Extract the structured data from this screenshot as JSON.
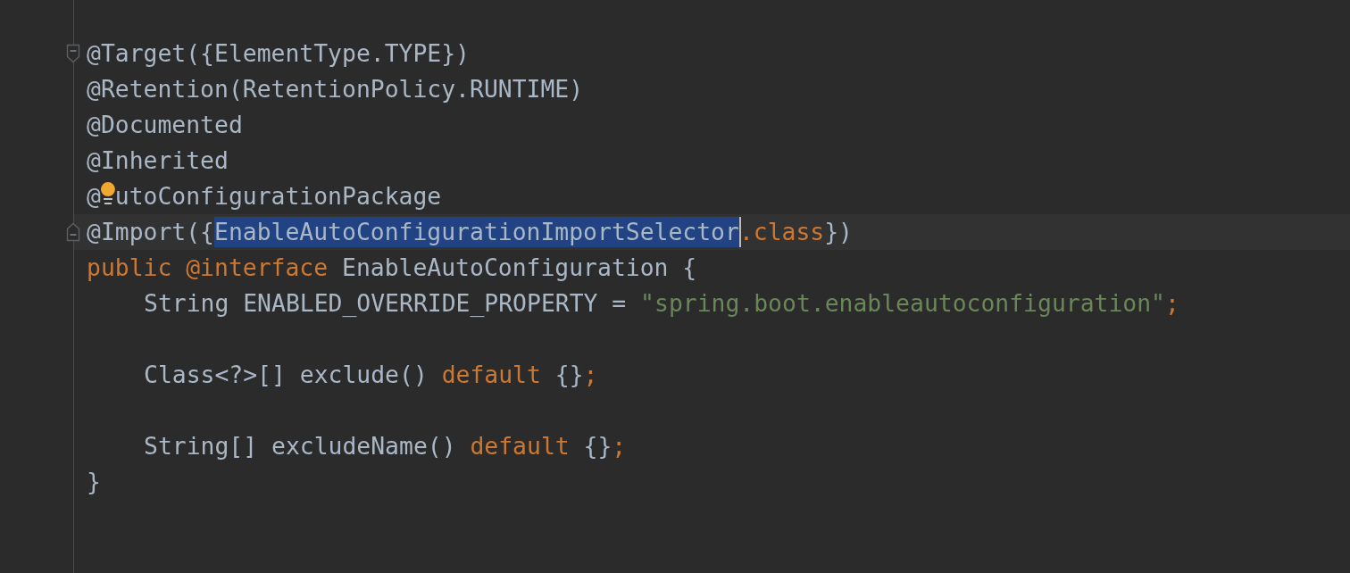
{
  "editor": {
    "lines": [
      {
        "kind": "code",
        "fold_start": true,
        "tokens": [
          {
            "text": "@Target({ElementType.TYPE})",
            "kind": "plain"
          }
        ]
      },
      {
        "kind": "code",
        "tokens": [
          {
            "text": "@Retention(RetentionPolicy.RUNTIME)",
            "kind": "plain"
          }
        ]
      },
      {
        "kind": "code",
        "tokens": [
          {
            "text": "@Documented",
            "kind": "plain"
          }
        ]
      },
      {
        "kind": "code",
        "tokens": [
          {
            "text": "@Inherited",
            "kind": "plain"
          }
        ]
      },
      {
        "kind": "code",
        "tokens": [
          {
            "text": "@",
            "kind": "plain"
          },
          {
            "kind": "bulb"
          },
          {
            "text": "utoConfigurationPackage",
            "kind": "plain"
          }
        ]
      },
      {
        "kind": "code",
        "fold_end": true,
        "current": true,
        "tokens": [
          {
            "text": "@Import({",
            "kind": "plain"
          },
          {
            "text": "EnableAutoConfigurationImportSelector",
            "kind": "selection",
            "caret": true
          },
          {
            "text": ".class",
            "kind": "keyword"
          },
          {
            "text": "})",
            "kind": "plain"
          }
        ]
      },
      {
        "kind": "code",
        "tokens": [
          {
            "text": "public @interface",
            "kind": "keyword"
          },
          {
            "text": "EnableAutoConfiguration {",
            "kind": "plain",
            "space_before": true
          }
        ]
      },
      {
        "kind": "code",
        "indented": true,
        "tokens": [
          {
            "text": "String ENABLED_OVERRIDE_PROPERTY =",
            "kind": "plain"
          },
          {
            "text": "\"spring.boot.enableautoconfiguration\"",
            "kind": "string",
            "space_before": true
          },
          {
            "text": ";",
            "kind": "keyword"
          }
        ]
      },
      {
        "kind": "blank"
      },
      {
        "kind": "code",
        "indented": true,
        "tokens": [
          {
            "text": "Class<?>[] exclude()",
            "kind": "plain"
          },
          {
            "text": "default",
            "kind": "keyword",
            "space_before": true
          },
          {
            "text": "{}",
            "kind": "plain",
            "space_before": true
          },
          {
            "text": ";",
            "kind": "keyword"
          }
        ]
      },
      {
        "kind": "blank"
      },
      {
        "kind": "code",
        "indented": true,
        "tokens": [
          {
            "text": "String[] excludeName()",
            "kind": "plain"
          },
          {
            "text": "default",
            "kind": "keyword",
            "space_before": true
          },
          {
            "text": "{}",
            "kind": "plain",
            "space_before": true
          },
          {
            "text": ";",
            "kind": "keyword"
          }
        ]
      },
      {
        "kind": "code",
        "tokens": [
          {
            "text": "}",
            "kind": "plain"
          }
        ]
      }
    ]
  }
}
